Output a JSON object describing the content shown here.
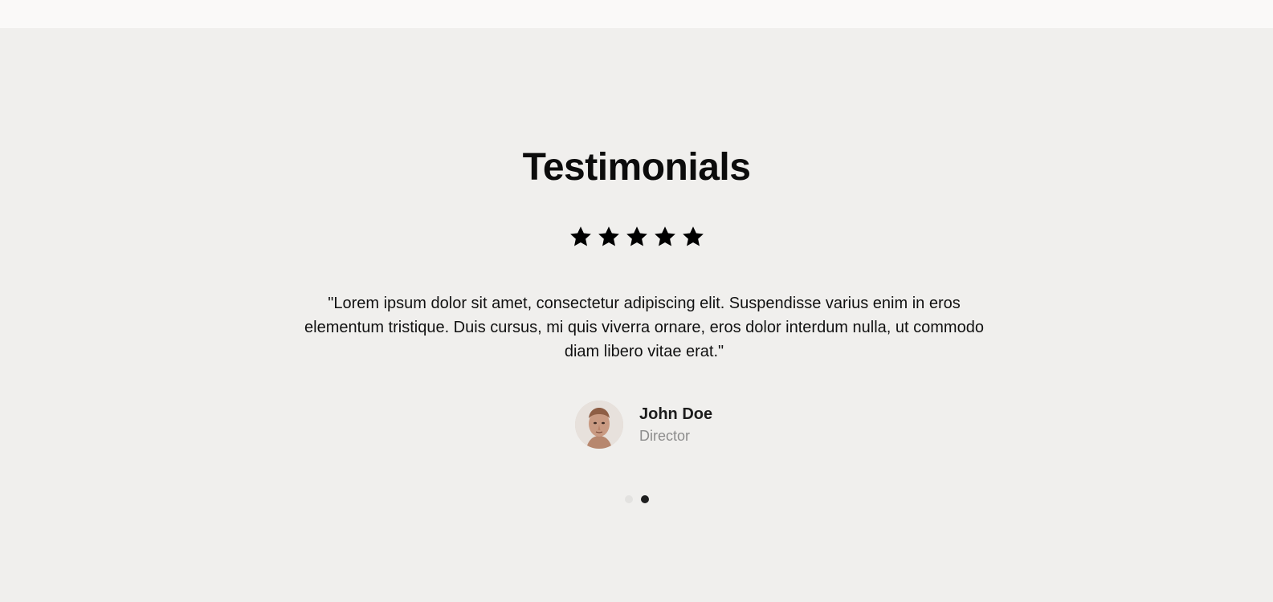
{
  "section": {
    "title": "Testimonials",
    "rating": 5,
    "quote": "\"Lorem ipsum dolor sit amet, consectetur adipiscing elit. Suspendisse varius enim in eros elementum tristique. Duis cursus, mi quis viverra ornare, eros dolor interdum nulla, ut commodo diam libero vitae erat.\"",
    "author": {
      "name": "John Doe",
      "role": "Director"
    },
    "pagination": {
      "total": 2,
      "active_index": 2
    }
  },
  "icons": {
    "star": "star-icon"
  },
  "colors": {
    "background": "#f0efed",
    "top_strip": "#faf9f8",
    "text": "#111111",
    "muted": "#8c8c8c",
    "dot_inactive": "#e3e2e0",
    "dot_active": "#1f1f1f"
  }
}
